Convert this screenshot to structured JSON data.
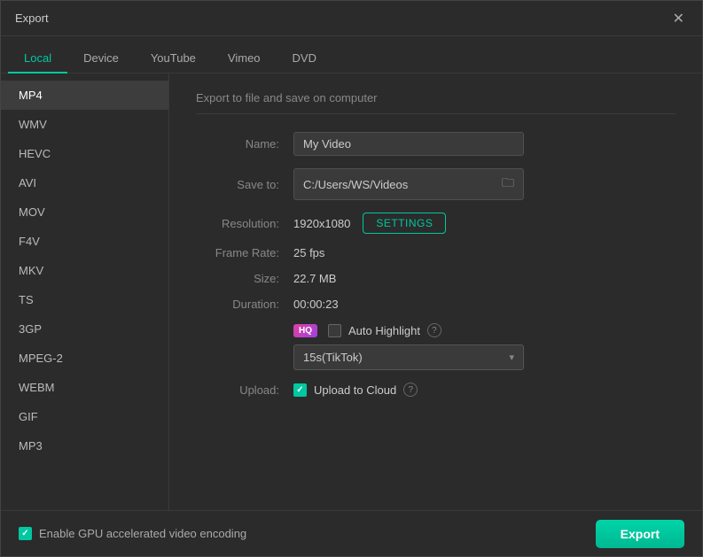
{
  "window": {
    "title": "Export"
  },
  "tabs": [
    {
      "id": "local",
      "label": "Local",
      "active": true
    },
    {
      "id": "device",
      "label": "Device",
      "active": false
    },
    {
      "id": "youtube",
      "label": "YouTube",
      "active": false
    },
    {
      "id": "vimeo",
      "label": "Vimeo",
      "active": false
    },
    {
      "id": "dvd",
      "label": "DVD",
      "active": false
    }
  ],
  "sidebar": {
    "items": [
      {
        "id": "mp4",
        "label": "MP4",
        "active": true
      },
      {
        "id": "wmv",
        "label": "WMV",
        "active": false
      },
      {
        "id": "hevc",
        "label": "HEVC",
        "active": false
      },
      {
        "id": "avi",
        "label": "AVI",
        "active": false
      },
      {
        "id": "mov",
        "label": "MOV",
        "active": false
      },
      {
        "id": "f4v",
        "label": "F4V",
        "active": false
      },
      {
        "id": "mkv",
        "label": "MKV",
        "active": false
      },
      {
        "id": "ts",
        "label": "TS",
        "active": false
      },
      {
        "id": "3gp",
        "label": "3GP",
        "active": false
      },
      {
        "id": "mpeg2",
        "label": "MPEG-2",
        "active": false
      },
      {
        "id": "webm",
        "label": "WEBM",
        "active": false
      },
      {
        "id": "gif",
        "label": "GIF",
        "active": false
      },
      {
        "id": "mp3",
        "label": "MP3",
        "active": false
      }
    ]
  },
  "panel": {
    "description": "Export to file and save on computer",
    "fields": {
      "name_label": "Name:",
      "name_value": "My Video",
      "save_to_label": "Save to:",
      "save_to_path": "C:/Users/WS/Videos",
      "resolution_label": "Resolution:",
      "resolution_value": "1920x1080",
      "settings_btn": "SETTINGS",
      "frame_rate_label": "Frame Rate:",
      "frame_rate_value": "25 fps",
      "size_label": "Size:",
      "size_value": "22.7 MB",
      "duration_label": "Duration:",
      "duration_value": "00:00:23",
      "auto_highlight_label": "Auto Highlight",
      "hq_badge": "HQ",
      "dropdown_value": "15s(TikTok)",
      "upload_label": "Upload:",
      "upload_to_cloud_label": "Upload to Cloud"
    },
    "auto_highlight_checked": false,
    "upload_checked": true
  },
  "bottom": {
    "gpu_label": "Enable GPU accelerated video encoding",
    "gpu_checked": true,
    "export_btn": "Export"
  },
  "icons": {
    "close": "✕",
    "folder": "🗀",
    "info": "?",
    "dropdown_arrow": "▾",
    "checkmark": "✓"
  }
}
